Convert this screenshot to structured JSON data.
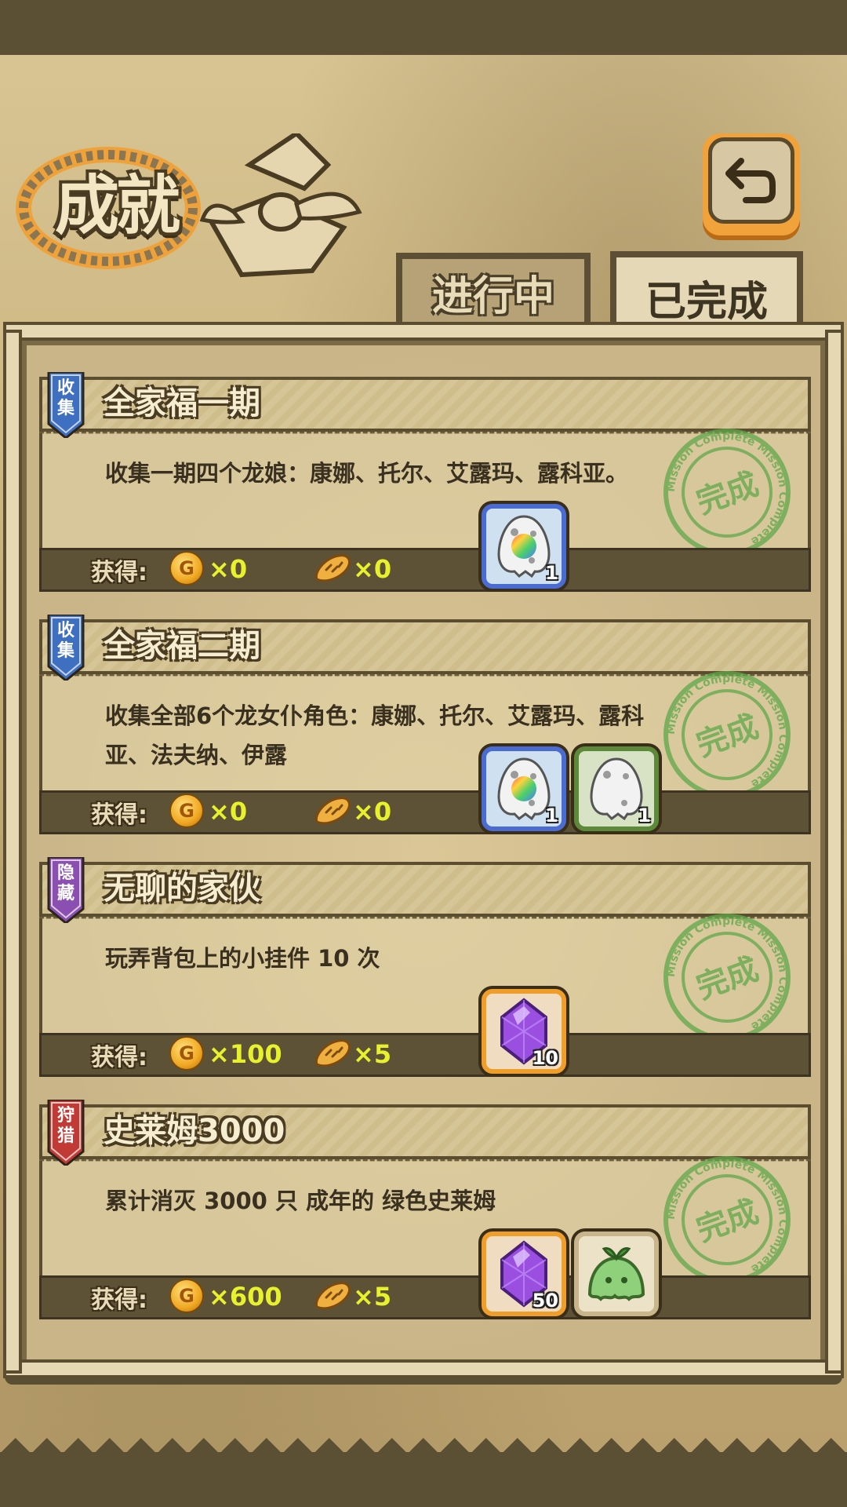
{
  "header": {
    "title": "成就",
    "back_icon": "return-arrow-icon"
  },
  "tabs": [
    {
      "label": "进行中",
      "active": false
    },
    {
      "label": "已完成",
      "active": true
    }
  ],
  "stamp_text": "完成",
  "stamp_ring_text": "Mission Complete",
  "reward_label": "获得:",
  "coin_symbol": "G",
  "achievements": [
    {
      "badge": "收集",
      "badge_color": "#3f6fc0",
      "title": "全家福一期",
      "desc": "收集一期四个龙娘：康娜、托尔、艾露玛、露科亚。",
      "coins": "×0",
      "bread": "×0",
      "items": [
        {
          "icon": "rainbow-egg-icon",
          "frame": "blue",
          "count": "1"
        }
      ]
    },
    {
      "badge": "收集",
      "badge_color": "#3f6fc0",
      "title": "全家福二期",
      "desc": "收集全部6个龙女仆角色：康娜、托尔、艾露玛、露科亚、法夫纳、伊露",
      "coins": "×0",
      "bread": "×0",
      "items": [
        {
          "icon": "rainbow-egg-icon",
          "frame": "blue",
          "count": "1"
        },
        {
          "icon": "white-egg-icon",
          "frame": "green",
          "count": "1"
        }
      ]
    },
    {
      "badge": "隐藏",
      "badge_color": "#8a4fb0",
      "title": "无聊的家伙",
      "desc": "玩弄背包上的小挂件 10 次",
      "coins": "×100",
      "bread": "×5",
      "items": [
        {
          "icon": "purple-crystal-icon",
          "frame": "orange",
          "count": "10"
        }
      ]
    },
    {
      "badge": "狩猎",
      "badge_color": "#c23a35",
      "title": "史莱姆3000",
      "desc": "累计消灭 3000 只 成年的 绿色史莱姆",
      "coins": "×600",
      "bread": "×5",
      "items": [
        {
          "icon": "purple-crystal-icon",
          "frame": "orange",
          "count": "50"
        },
        {
          "icon": "green-slime-icon",
          "frame": "tan",
          "count": ""
        }
      ]
    }
  ]
}
